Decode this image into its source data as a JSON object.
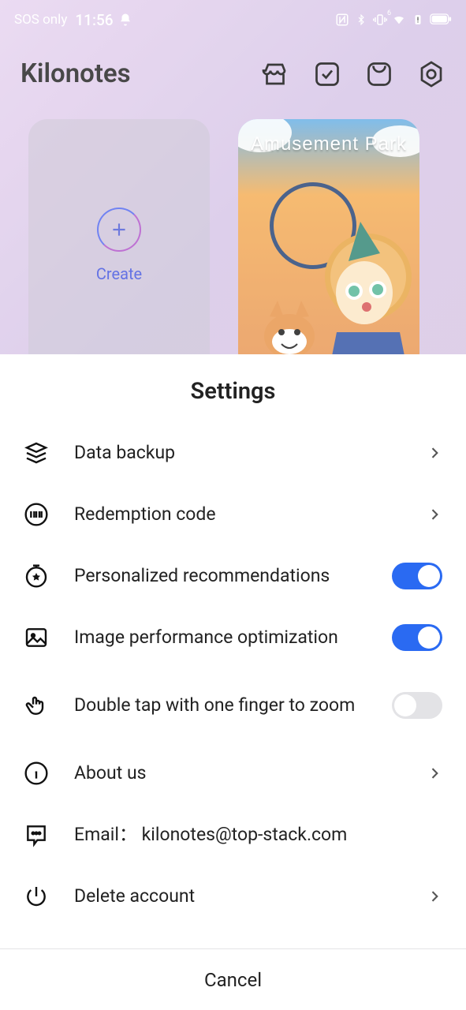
{
  "status": {
    "sos": "SOS only",
    "time": "11:56"
  },
  "app": {
    "title": "Kilonotes"
  },
  "cards": {
    "create_label": "Create",
    "amusement_title": "Amusement Park"
  },
  "sheet": {
    "title": "Settings",
    "items": {
      "backup": "Data backup",
      "redemption": "Redemption code",
      "personalized": "Personalized recommendations",
      "image_perf": "Image performance optimization",
      "double_tap": "Double tap with one finger to zoom",
      "about": "About us",
      "email": "Email： kilonotes@top-stack.com",
      "delete": "Delete account"
    },
    "toggles": {
      "personalized": true,
      "image_perf": true,
      "double_tap": false
    },
    "cancel": "Cancel"
  }
}
